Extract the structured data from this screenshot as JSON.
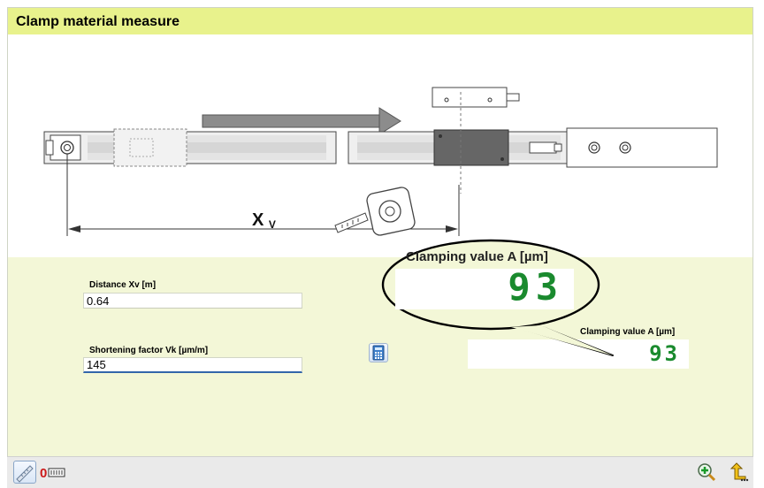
{
  "window": {
    "title": "Clamp material measure"
  },
  "diagram": {
    "distance_symbol": "X",
    "distance_subscript": "V"
  },
  "form": {
    "distance": {
      "label": "Distance Xv [m]",
      "value": "0.64"
    },
    "shortening": {
      "label": "Shortening factor Vk [µm/m]",
      "value": "145"
    }
  },
  "result": {
    "label": "Clamping value A [µm]",
    "value": "93"
  },
  "bubble": {
    "label": "Clamping value A [µm]",
    "value": "93"
  },
  "toolbar": {
    "left": [
      "measure-scale-icon",
      "reset-counter-icon"
    ],
    "right": [
      "zoom-in-icon",
      "back-icon"
    ]
  },
  "colors": {
    "title_bar": "#e8f28c",
    "form_background": "#f3f7d7",
    "digit_green": "#1a8a2e"
  }
}
